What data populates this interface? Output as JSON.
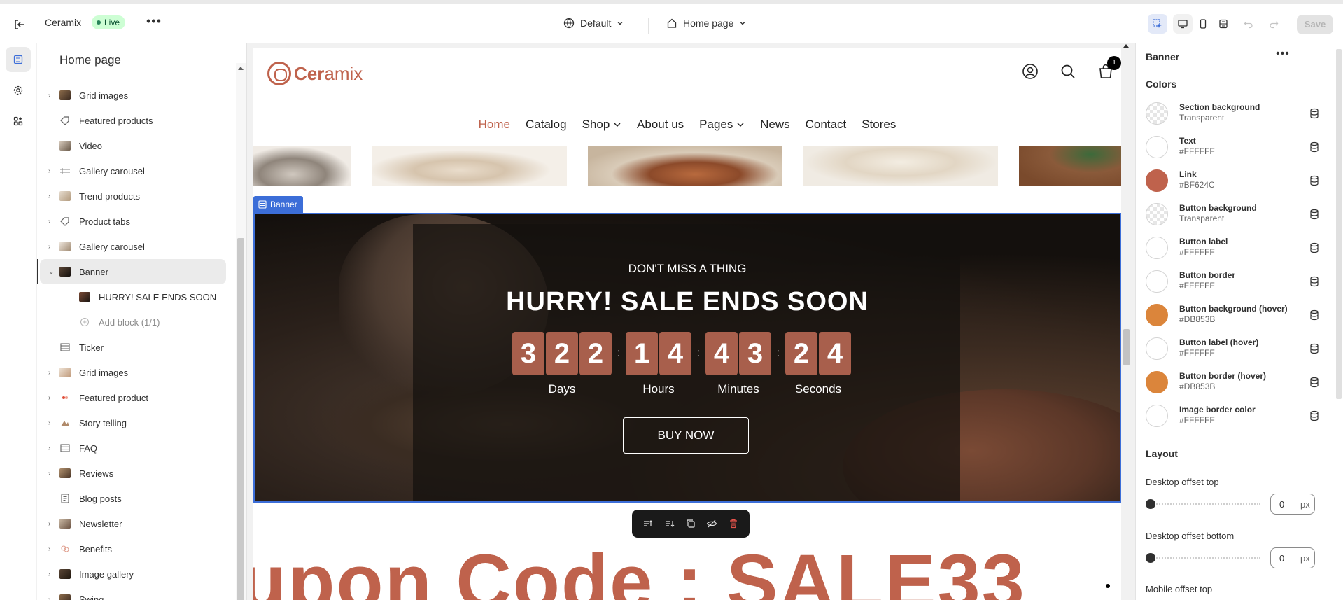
{
  "topbar": {
    "store_name": "Ceramix",
    "status": "Live",
    "theme": "Default",
    "page": "Home page",
    "save_label": "Save"
  },
  "sidebar": {
    "title": "Home page",
    "items": [
      {
        "label": "Grid images",
        "icon": "image-group-icon"
      },
      {
        "label": "Featured products",
        "icon": "tag-icon"
      },
      {
        "label": "Video",
        "icon": "video-icon"
      },
      {
        "label": "Gallery carousel",
        "icon": "gallery-icon"
      },
      {
        "label": "Trend products",
        "icon": "image-group-icon"
      },
      {
        "label": "Product tabs",
        "icon": "tag-icon"
      },
      {
        "label": "Gallery carousel",
        "icon": "image-group-icon"
      },
      {
        "label": "Banner",
        "icon": "image-group-icon"
      },
      {
        "label": "HURRY! SALE ENDS SOON",
        "icon": "image-block-icon"
      },
      {
        "label": "Add block (1/1)",
        "icon": "plus-circle-icon"
      },
      {
        "label": "Ticker",
        "icon": "ticker-icon"
      },
      {
        "label": "Grid images",
        "icon": "image-group-icon"
      },
      {
        "label": "Featured product",
        "icon": "featured-product-icon"
      },
      {
        "label": "Story telling",
        "icon": "story-icon"
      },
      {
        "label": "FAQ",
        "icon": "faq-icon"
      },
      {
        "label": "Reviews",
        "icon": "image-group-icon"
      },
      {
        "label": "Blog posts",
        "icon": "blog-icon"
      },
      {
        "label": "Newsletter",
        "icon": "image-group-icon"
      },
      {
        "label": "Benefits",
        "icon": "benefits-icon"
      },
      {
        "label": "Image gallery",
        "icon": "image-group-icon"
      },
      {
        "label": "Swing",
        "icon": "image-group-icon"
      }
    ]
  },
  "preview": {
    "logo_bold": "Cer",
    "logo_light": "amix",
    "cart_count": "1",
    "nav": [
      "Home",
      "Catalog",
      "Shop",
      "About us",
      "Pages",
      "News",
      "Contact",
      "Stores"
    ],
    "banner_tag": "Banner",
    "banner_subtitle": "DON'T MISS A THING",
    "banner_title": "HURRY! SALE ENDS SOON",
    "countdown": [
      {
        "digits": [
          "3",
          "2",
          "2"
        ],
        "label": "Days"
      },
      {
        "digits": [
          "1",
          "4"
        ],
        "label": "Hours"
      },
      {
        "digits": [
          "4",
          "3"
        ],
        "label": "Minutes"
      },
      {
        "digits": [
          "2",
          "4"
        ],
        "label": "Seconds"
      }
    ],
    "separator": ":",
    "buy_label": "BUY NOW",
    "coupon_text": "upon Code : SALE33"
  },
  "settings": {
    "panel_title": "Banner",
    "colors_heading": "Colors",
    "colors": [
      {
        "name": "Section background",
        "value": "Transparent",
        "hex": "transparent"
      },
      {
        "name": "Text",
        "value": "#FFFFFF",
        "hex": "#FFFFFF"
      },
      {
        "name": "Link",
        "value": "#BF624C",
        "hex": "#BF624C"
      },
      {
        "name": "Button background",
        "value": "Transparent",
        "hex": "transparent"
      },
      {
        "name": "Button label",
        "value": "#FFFFFF",
        "hex": "#FFFFFF"
      },
      {
        "name": "Button border",
        "value": "#FFFFFF",
        "hex": "#FFFFFF"
      },
      {
        "name": "Button background (hover)",
        "value": "#DB853B",
        "hex": "#DB853B"
      },
      {
        "name": "Button label (hover)",
        "value": "#FFFFFF",
        "hex": "#FFFFFF"
      },
      {
        "name": "Button border (hover)",
        "value": "#DB853B",
        "hex": "#DB853B"
      },
      {
        "name": "Image border color",
        "value": "#FFFFFF",
        "hex": "#FFFFFF"
      }
    ],
    "layout_heading": "Layout",
    "desktop_offset_top_label": "Desktop offset top",
    "desktop_offset_top_value": "0",
    "desktop_offset_bottom_label": "Desktop offset bottom",
    "desktop_offset_bottom_value": "0",
    "unit": "px",
    "mobile_offset_top_label": "Mobile offset top"
  },
  "colors": {
    "accent": "#BF624C",
    "selection": "#3C6ED8",
    "digit_bg": "#A85F4C"
  }
}
